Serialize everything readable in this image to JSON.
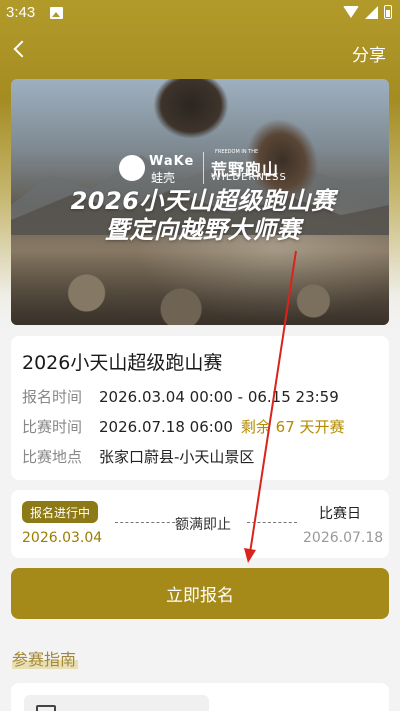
{
  "status_bar": {
    "time": "3:43"
  },
  "nav": {
    "share_label": "分享"
  },
  "banner": {
    "logo_left_en": "WaKe",
    "logo_left_cn": "蛙壳",
    "logo_right_small": "FREEDOM IN THE",
    "logo_right_cn": "荒野跑山",
    "logo_right_en": "WILDERNESS",
    "title_line1": "2026小天山超级跑山赛",
    "title_line2": "暨定向越野大师赛"
  },
  "event": {
    "title": "2026小天山超级跑山赛",
    "signup_label": "报名时间",
    "signup_value": "2026.03.04 00:00 - 06.15 23:59",
    "race_label": "比赛时间",
    "race_value": "2026.07.18 06:00",
    "countdown": "剩余 67 天开赛",
    "location_label": "比赛地点",
    "location_value": "张家口蔚县-小天山景区"
  },
  "timeline": {
    "status_badge": "报名进行中",
    "start_date": "2026.03.04",
    "middle_label": "额满即止",
    "race_day_label": "比赛日",
    "race_date": "2026.07.18"
  },
  "signup_button": {
    "label": "立即报名"
  },
  "guide": {
    "section_title": "参赛指南"
  },
  "colors": {
    "accent": "#a58a1a",
    "badge": "#8d7915",
    "countdown": "#b38b00",
    "annotation_arrow": "#d9231b"
  }
}
